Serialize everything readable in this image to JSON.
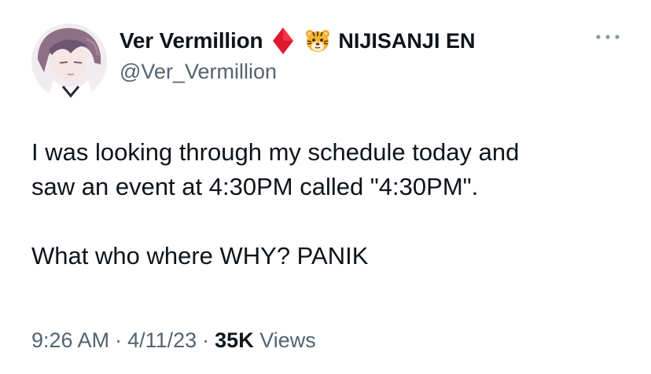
{
  "author": {
    "display_name": "Ver Vermillion",
    "affiliation": "NIJISANJI EN",
    "handle": "@Ver_Vermillion",
    "badge_icon": "red-diamond-icon",
    "affiliation_icon": "tiger-face-icon"
  },
  "tweet": {
    "line1": "I was looking through my schedule today and",
    "line2": "saw an event at 4:30PM called \"4:30PM\".",
    "line3": "What who where WHY? PANIK"
  },
  "meta": {
    "time": "9:26 AM",
    "separator": "·",
    "date": "4/11/23",
    "views_count": "35K",
    "views_label": "Views"
  },
  "colors": {
    "text": "#0f1419",
    "secondary": "#536471",
    "diamond": "#e0182d"
  }
}
